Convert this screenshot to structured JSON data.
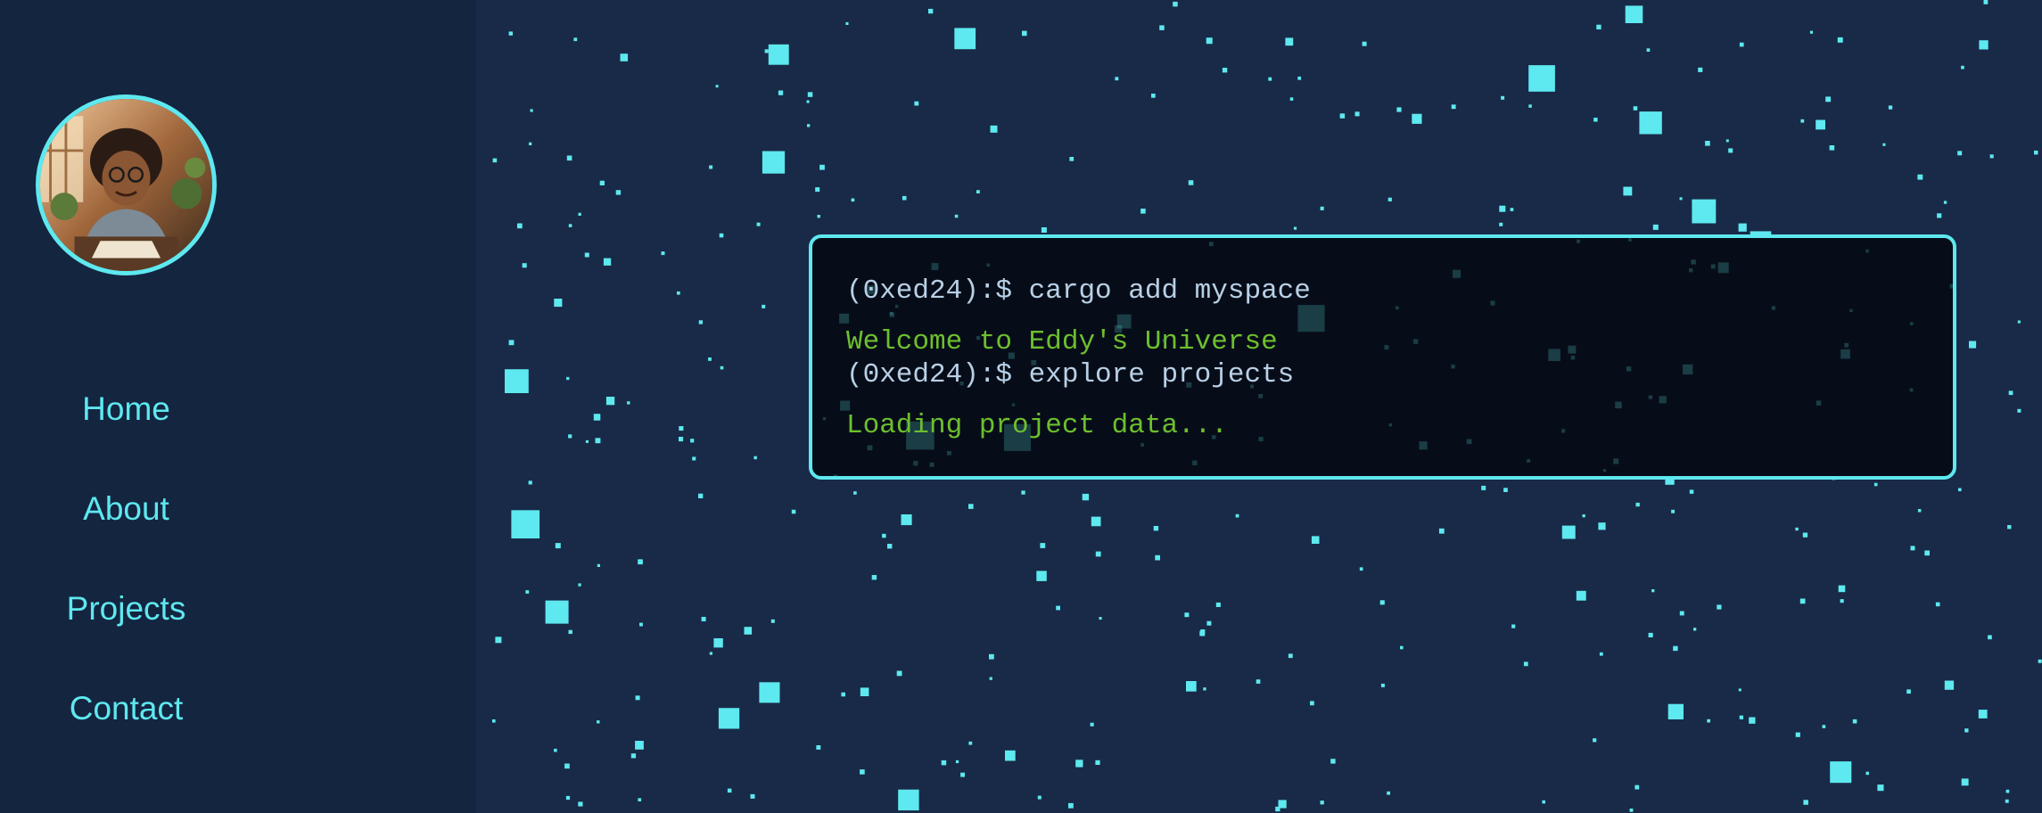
{
  "sidebar": {
    "avatar_alt": "Eddy",
    "nav": [
      {
        "label": "Home"
      },
      {
        "label": "About"
      },
      {
        "label": "Projects"
      },
      {
        "label": "Contact"
      }
    ]
  },
  "terminal": {
    "lines": [
      {
        "type": "command",
        "text": "(0xed24):$ cargo add myspace"
      },
      {
        "type": "output",
        "text": "Welcome to Eddy's Universe"
      },
      {
        "type": "command",
        "text": "(0xed24):$ explore projects"
      },
      {
        "type": "output",
        "text": "Loading project data..."
      }
    ]
  },
  "colors": {
    "accent": "#5ee8ef",
    "sidebar_bg": "#142540",
    "main_bg": "#182a47",
    "terminal_bg": "#070d18",
    "command_text": "#b8d0e6",
    "output_text": "#6dbf2f"
  }
}
